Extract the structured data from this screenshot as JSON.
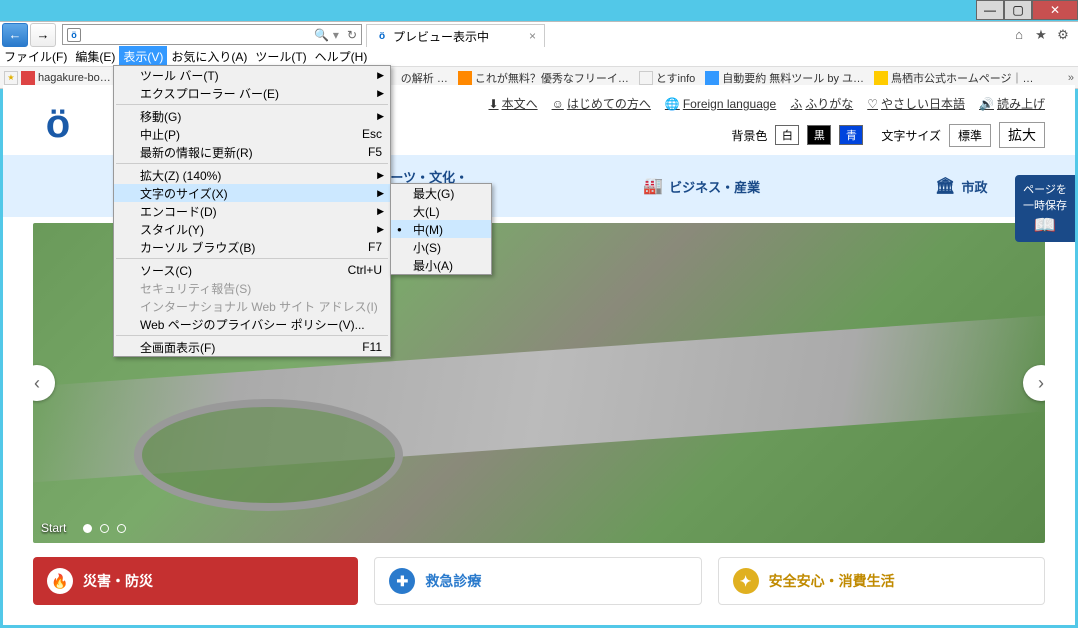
{
  "window": {
    "min": "—",
    "max": "▢",
    "close": "✕"
  },
  "browser": {
    "back": "←",
    "fwd": "→",
    "search_icon": "🔍",
    "refresh": "↻",
    "tab_title": "プレビュー表示中",
    "tools": {
      "home": "⌂",
      "star": "★",
      "gear": "⚙"
    },
    "chevrons": "»"
  },
  "menubar": {
    "file": "ファイル(F)",
    "edit": "編集(E)",
    "view": "表示(V)",
    "fav": "お気に入り(A)",
    "tools": "ツール(T)",
    "help": "ヘルプ(H)"
  },
  "favbar": {
    "items": [
      "hagakure-bo…",
      "の解析 …",
      "これが無料？優秀なフリーイ…",
      "とすinfo",
      "自動要約 無料ツール by ユ…",
      "鳥栖市公式ホームページ｜…"
    ]
  },
  "view_menu": {
    "toolbars": "ツール バー(T)",
    "explorer_bars": "エクスプローラー バー(E)",
    "goto": "移動(G)",
    "stop": "中止(P)",
    "stop_kb": "Esc",
    "refresh": "最新の情報に更新(R)",
    "refresh_kb": "F5",
    "zoom": "拡大(Z) (140%)",
    "textsize": "文字のサイズ(X)",
    "encoding": "エンコード(D)",
    "style": "スタイル(Y)",
    "caret": "カーソル ブラウズ(B)",
    "caret_kb": "F7",
    "source": "ソース(C)",
    "source_kb": "Ctrl+U",
    "security": "セキュリティ報告(S)",
    "intl": "インターナショナル Web サイト アドレス(I)",
    "privacy": "Web ページのプライバシー ポリシー(V)...",
    "fullscreen": "全画面表示(F)",
    "fullscreen_kb": "F11"
  },
  "textsize_menu": {
    "largest": "最大(G)",
    "larger": "大(L)",
    "medium": "中(M)",
    "smaller": "小(S)",
    "smallest": "最小(A)"
  },
  "site": {
    "utils": {
      "main": "本文へ",
      "first": "はじめての方へ",
      "lang": "Foreign language",
      "furigana": "ふりがな",
      "easy": "やさしい日本語",
      "tts": "読み上げ"
    },
    "opts": {
      "bg_label": "背景色",
      "bg_w": "白",
      "bg_k": "黒",
      "bg_b": "青",
      "fs_label": "文字サイズ",
      "fs_std": "標準",
      "fs_lg": "拡大"
    },
    "save": {
      "line1": "ページを",
      "line2": "一時保存"
    },
    "nav": {
      "n1": "スポーツ・文化・\nイベント",
      "n2": "ビジネス・産業",
      "n3": "市政"
    },
    "hero": {
      "start": "Start"
    },
    "cards": {
      "c1": "災害・防災",
      "c2": "救急診療",
      "c3": "安全安心・消費生活"
    }
  }
}
